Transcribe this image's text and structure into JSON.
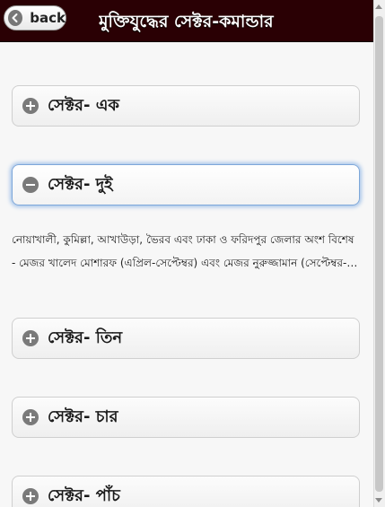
{
  "header": {
    "back_label": "back",
    "title": "মুক্তিযুদ্ধের সেক্টর-কমান্ডার"
  },
  "sections": [
    {
      "label": "সেক্টর- এক",
      "expanded": false
    },
    {
      "label": "সেক্টর- দুই",
      "expanded": true
    },
    {
      "label": "সেক্টর- তিন",
      "expanded": false
    },
    {
      "label": "সেক্টর- চার",
      "expanded": false
    },
    {
      "label": "সেক্টর- পাঁচ",
      "expanded": false
    }
  ],
  "expanded_content": {
    "area": "নোয়াখালী, কুমিল্লা, আখাউড়া, ভৈরব এবং ঢাকা ও ফরিদপুর জেলার অংশ বিশেষ",
    "commanders": "- মেজর খালেদ মোশারফ (এপ্রিল-সেপ্টেম্বর) এবং মেজর নুরুজ্জামান (সেপ্টেম্বর-ডিসেম্বর)"
  },
  "icons": {
    "back": "back-arrow-icon",
    "collapsed": "plus-icon",
    "expanded": "minus-icon"
  },
  "colors": {
    "header_bg": "#2a0004",
    "active_border": "#7da7d9"
  }
}
